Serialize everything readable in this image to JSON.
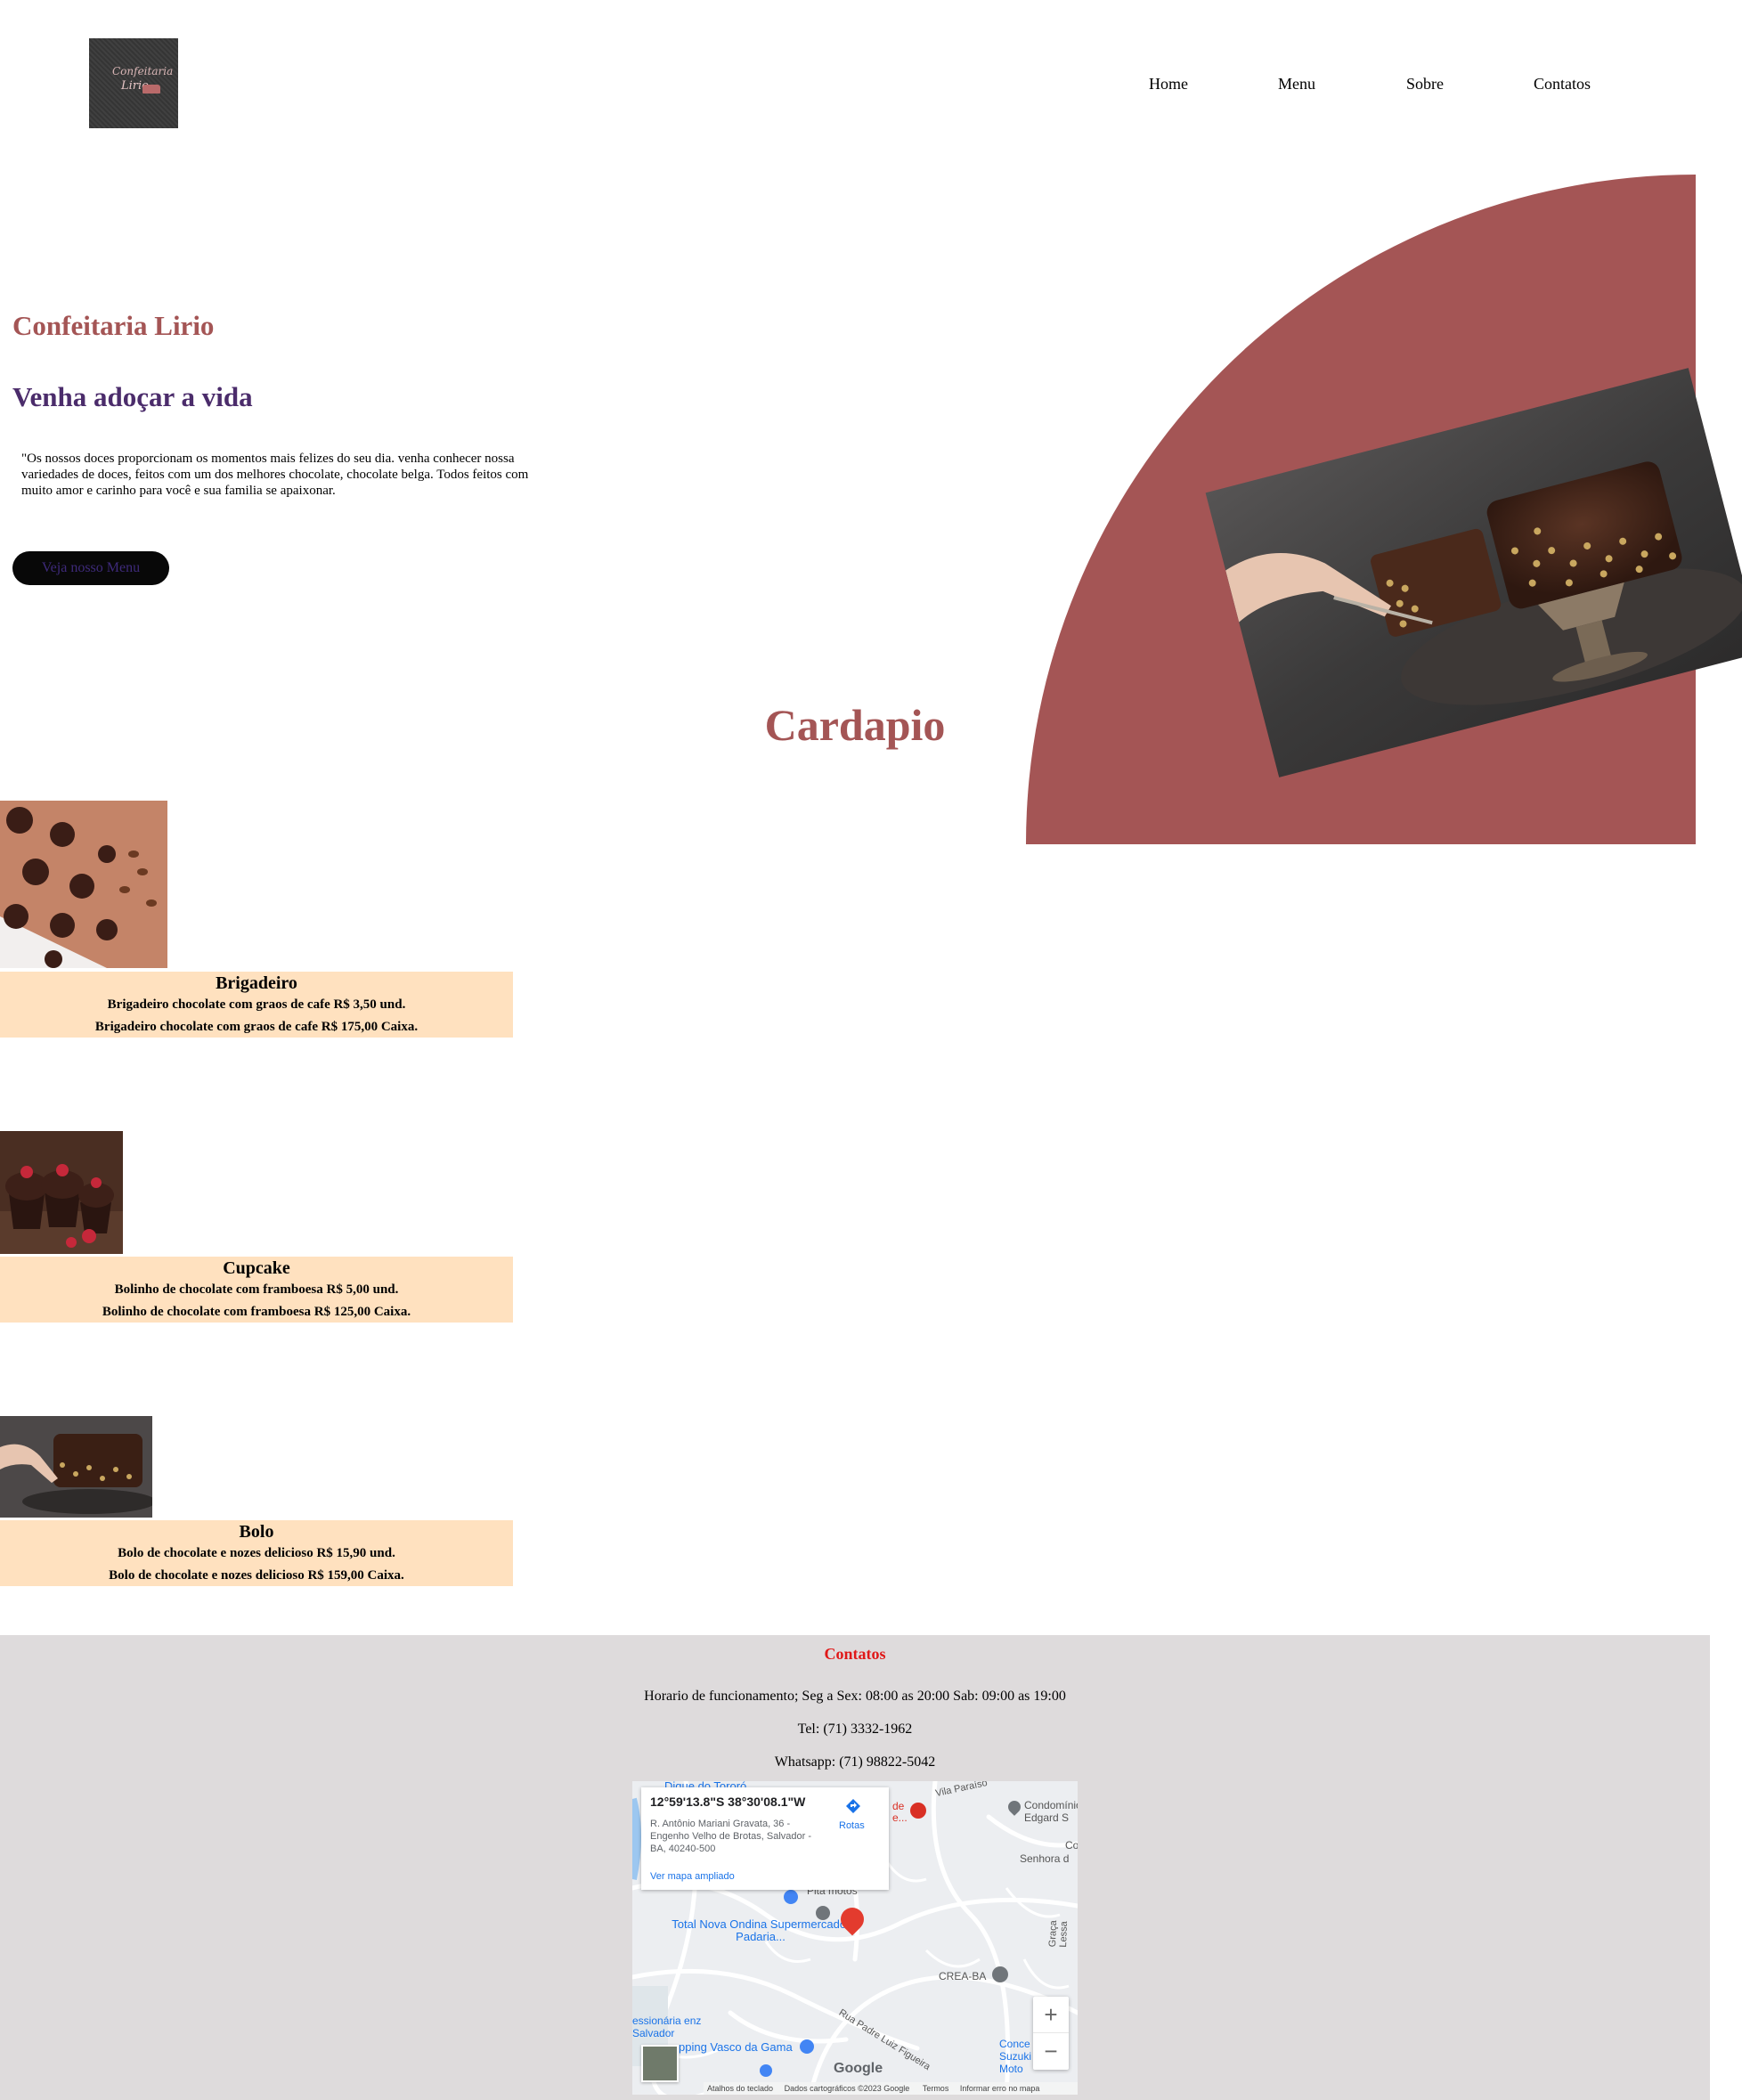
{
  "header": {
    "logo": {
      "line1": "Confeitaria",
      "line2": "Lirio"
    },
    "nav": [
      "Home",
      "Menu",
      "Sobre",
      "Contatos"
    ]
  },
  "hero": {
    "title": "Confeitaria Lirio",
    "subtitle": "Venha adoçar a vida",
    "description": "\"Os nossos doces proporcionam os momentos mais felizes do seu dia. venha conhecer nossa variedades de doces, feitos com um dos melhores chocolate, chocolate belga. Todos feitos com muito amor e carinho para você e sua familia se apaixonar.",
    "button": "Veja nosso Menu",
    "accent_color": "#a45555",
    "subtitle_color": "#4b2c6b"
  },
  "cardapio": {
    "title": "Cardapio",
    "items": [
      {
        "name": "Brigadeiro",
        "lines": [
          "Brigadeiro chocolate com graos de cafe R$ 3,50 und.",
          "Brigadeiro chocolate com graos de cafe R$ 175,00 Caixa."
        ]
      },
      {
        "name": "Cupcake",
        "lines": [
          "Bolinho de chocolate com framboesa R$ 5,00 und.",
          "Bolinho de chocolate com framboesa R$ 125,00 Caixa."
        ]
      },
      {
        "name": "Bolo",
        "lines": [
          "Bolo de chocolate e nozes delicioso R$ 15,90 und.",
          "Bolo de chocolate e nozes delicioso R$ 159,00 Caixa."
        ]
      }
    ],
    "item_bg_color": "#ffe1bf"
  },
  "footer": {
    "title": "Contatos",
    "hours": "Horario de funcionamento; Seg a Sex: 08:00 as 20:00 Sab: 09:00 as 19:00",
    "tel": "Tel: (71) 3332-1962",
    "whatsapp": "Whatsapp: (71) 98822-5042",
    "bg_color": "#dedbdc",
    "title_color": "#e01818"
  },
  "map": {
    "coords": "12°59'13.8\"S 38°30'08.1\"W",
    "address": "R. Antônio Mariani Gravata, 36 - Engenho Velho de Brotas, Salvador - BA, 40240-500",
    "directions": "Rotas",
    "larger_map": "Ver mapa ampliado",
    "places": [
      "Dique do Tororó",
      "Vila Paraíso",
      "de e...",
      "Condomínio Edgard S",
      "Senhora d",
      "Co",
      "Pita motos",
      "Total Nova Ondina Supermercado, Padaria...",
      "CREA-BA",
      "Graça Lessa",
      "Rua Padre Luiz Figueira",
      "essionária enz Salvador",
      "pping Vasco da Gama",
      "Conce Suzuki Moto"
    ],
    "footer_links": [
      "Atalhos do teclado",
      "Dados cartográficos ©2023 Google",
      "Termos",
      "Informar erro no mapa"
    ],
    "zoom_in": "+",
    "zoom_out": "−",
    "brand": "Google"
  }
}
